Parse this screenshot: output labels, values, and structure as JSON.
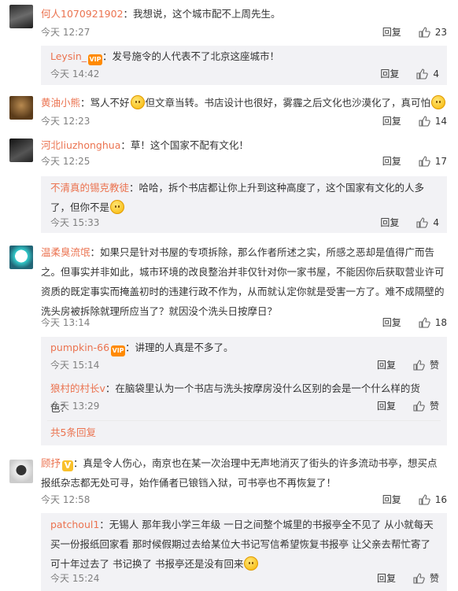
{
  "actions": {
    "reply": "回复",
    "like_label": "赞"
  },
  "comments": [
    {
      "user": "何人1070921902",
      "text": "：我想说，这个城市配不上周先生。",
      "time": "今天 12:27",
      "likes": "23"
    },
    {
      "user": "Leysin_",
      "text": "：发号施令的人代表不了北京这座城市！",
      "time": "今天 14:42",
      "likes": "4"
    },
    {
      "user": "黄油小熊",
      "text1": "：骂人不好",
      "text2": "但文章当转。书店设计也很好，雾霾之后文化也沙漠化了，真可怕",
      "time": "今天 12:23",
      "likes": "14"
    },
    {
      "user": "河北liuzhonghua",
      "text": "：草！这个国家不配有文化！",
      "time": "今天 12:25",
      "likes": "17"
    },
    {
      "user": "不清真的锡克教徒",
      "text": "：哈哈，拆个书店都让你上升到这种高度了，这个国家有文化的人多了，但你不是",
      "time": "今天 15:33",
      "likes": "4"
    },
    {
      "user": "温柔臭流氓",
      "text": "：如果只是针对书屋的专项拆除，那么作者所述之实，所感之恶却是值得广而告之。但事实并非如此，城市环境的改良整治并非仅针对你一家书屋，不能因你后获取营业许可资质的既定事实而掩盖初时的违建行政不作为，从而就认定你就是受害一方了。难不成隔壁的洗头房被拆除就理所应当了？就因没个洗头日按摩日？",
      "time": "今天 13:14",
      "likes": "18"
    },
    {
      "user": "pumpkin-66",
      "text": "：讲理的人真是不多了。",
      "time": "今天 15:14",
      "likes": "赞"
    },
    {
      "user": "狼村的村长v",
      "text": "：在脑袋里认为一个书店与洗头按摩房没什么区别的会是一个什么样的货色？",
      "time": "今天 13:29",
      "likes": "赞"
    },
    {
      "more": "共5条回复"
    },
    {
      "user": "顾抒",
      "text": "：真是令人伤心，南京也在某一次治理中无声地消灭了街头的许多流动书亭，想买点报纸杂志都无处可寻，始作俑者已锒铛入狱，可书亭也不再恢复了！",
      "time": "今天 12:58",
      "likes": "16"
    },
    {
      "user": "patchoul1",
      "text": "：无锡人 那年我小学三年级 一日之间整个城里的书报亭全不见了 从小就每天买一份报纸回家看 那时候假期过去给某位大书记写信希望恢复书报亭 让父亲去帮忙寄了 可十年过去了 书记换了 书报亭还是没有回来",
      "time": "今天 15:24",
      "likes": "赞"
    }
  ],
  "colors": {
    "name": "#eb7350",
    "meta": "#808080",
    "subbg": "#f2f2f5"
  }
}
